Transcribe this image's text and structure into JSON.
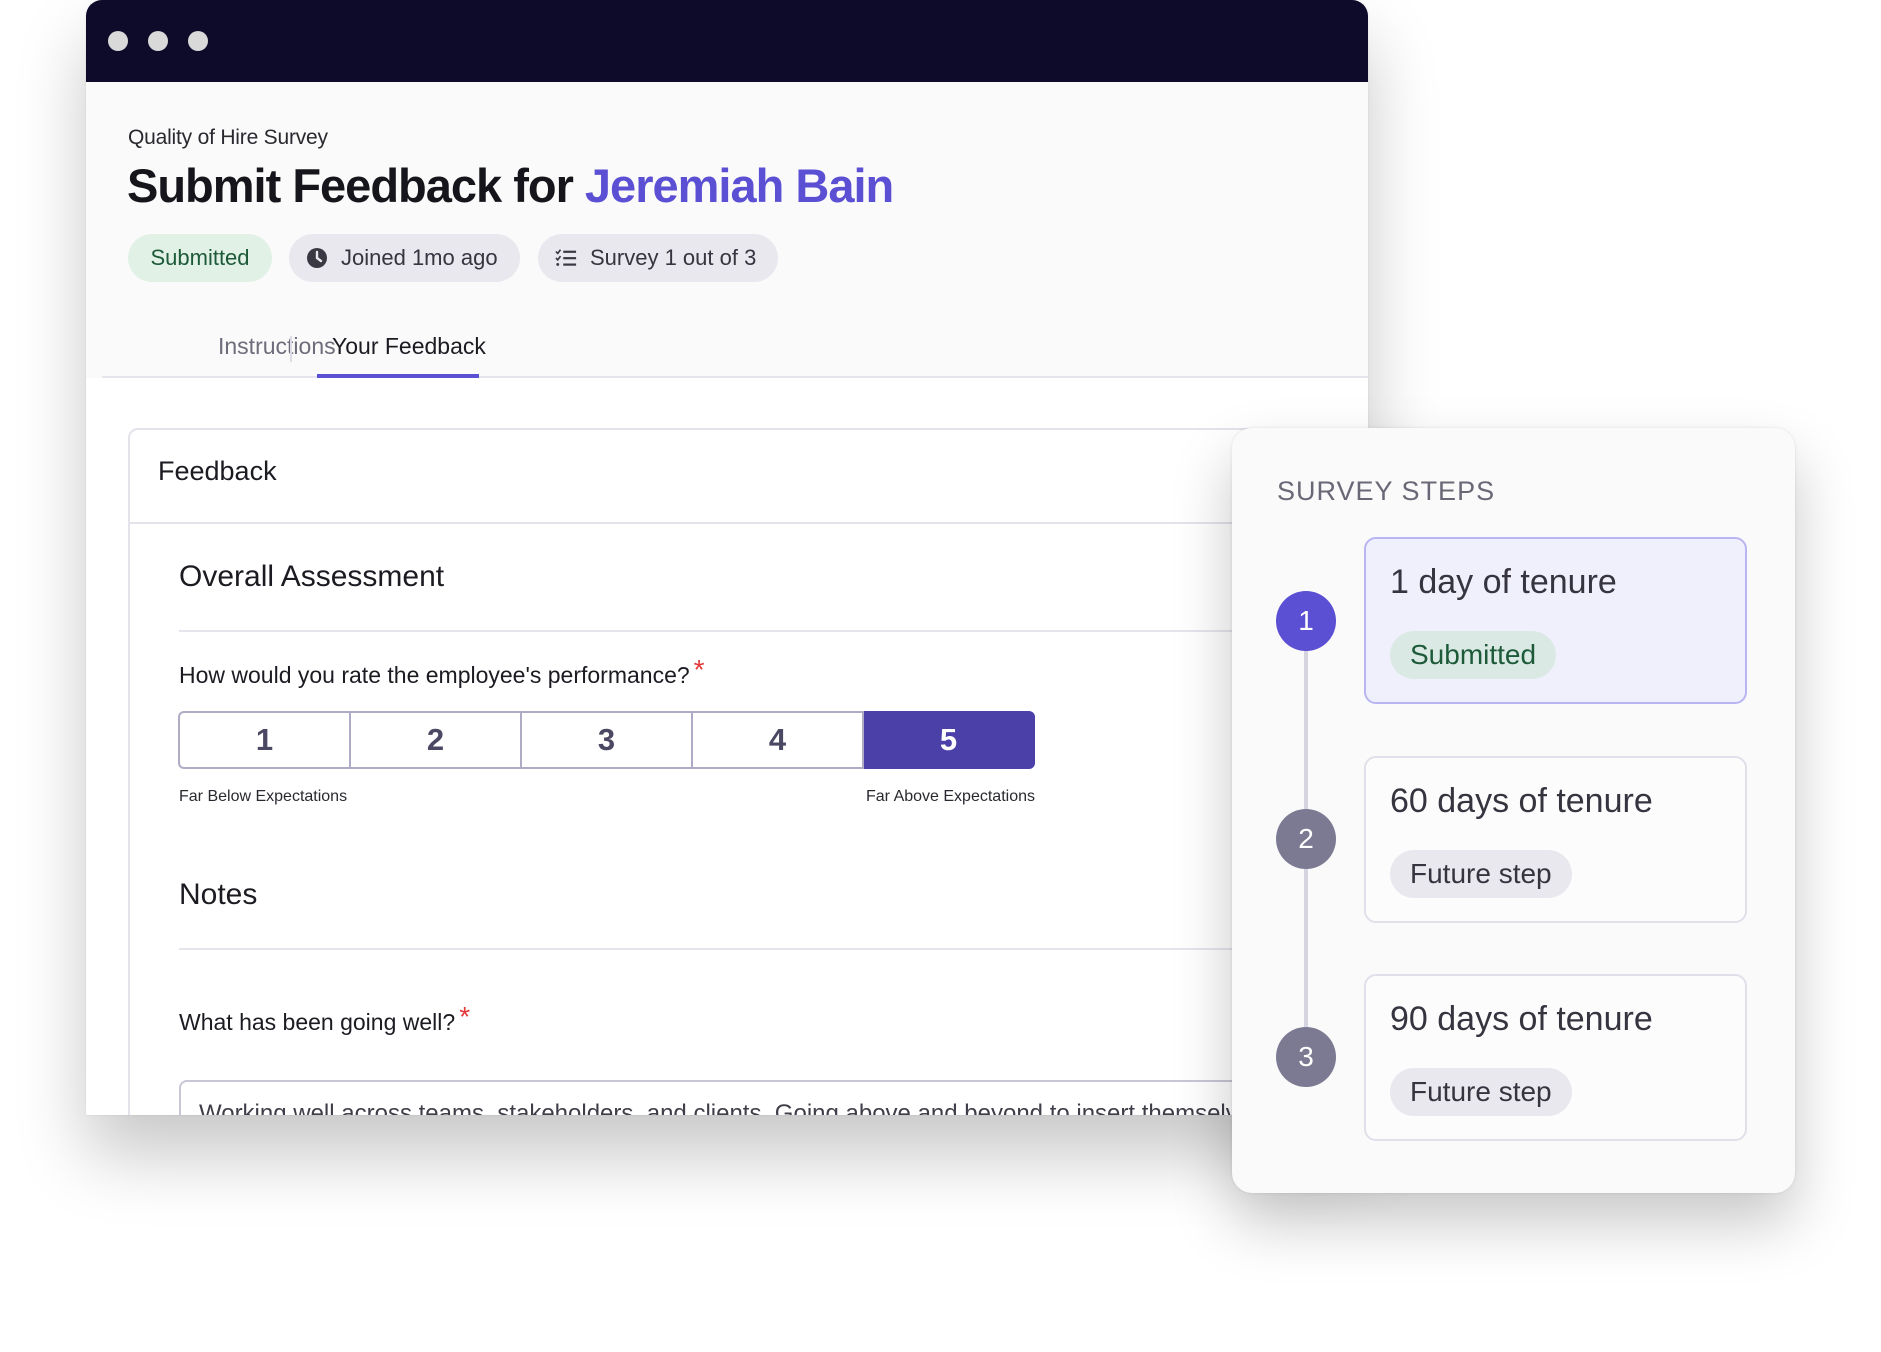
{
  "window": {
    "controls": [
      "close",
      "minimize",
      "maximize"
    ]
  },
  "header": {
    "subtitle": "Quality of Hire Survey",
    "title_prefix": "Submit Feedback for",
    "employee_name": "Jeremiah Bain",
    "badges": {
      "status": "Submitted",
      "joined": "Joined 1mo ago",
      "joined_icon": "clock-icon",
      "survey": "Survey 1 out of 3",
      "survey_icon": "checklist-icon"
    }
  },
  "tabs": [
    {
      "label": "Instructions",
      "active": false
    },
    {
      "label": "Your Feedback",
      "active": true
    }
  ],
  "feedback_card": {
    "title": "Feedback",
    "overall": {
      "section_title": "Overall Assessment",
      "question": "How would you rate the employee's performance?",
      "required_mark": "*",
      "options": [
        "1",
        "2",
        "3",
        "4",
        "5"
      ],
      "selected": "5",
      "low_label": "Far Below Expectations",
      "high_label": "Far Above Expectations"
    },
    "notes": {
      "section_title": "Notes",
      "question": "What has been going well?",
      "required_mark": "*",
      "answer": "Working well across teams, stakeholders, and clients. Going above and beyond to insert themselves into initiatives and projects."
    }
  },
  "survey_steps": {
    "title": "SURVEY STEPS",
    "steps": [
      {
        "number": "1",
        "label": "1 day of tenure",
        "status": "Submitted",
        "state": "active"
      },
      {
        "number": "2",
        "label": "60 days of tenure",
        "status": "Future step",
        "state": "future"
      },
      {
        "number": "3",
        "label": "90 days of tenure",
        "status": "Future step",
        "state": "future"
      }
    ]
  },
  "colors": {
    "accent": "#5b4fd4",
    "selected_rating": "#4a40a8",
    "titlebar": "#0e0b2a",
    "submitted_bg": "#e2f1e5",
    "submitted_text": "#1d5a39",
    "required": "#e5383b",
    "future_circle": "#7c7a93"
  }
}
